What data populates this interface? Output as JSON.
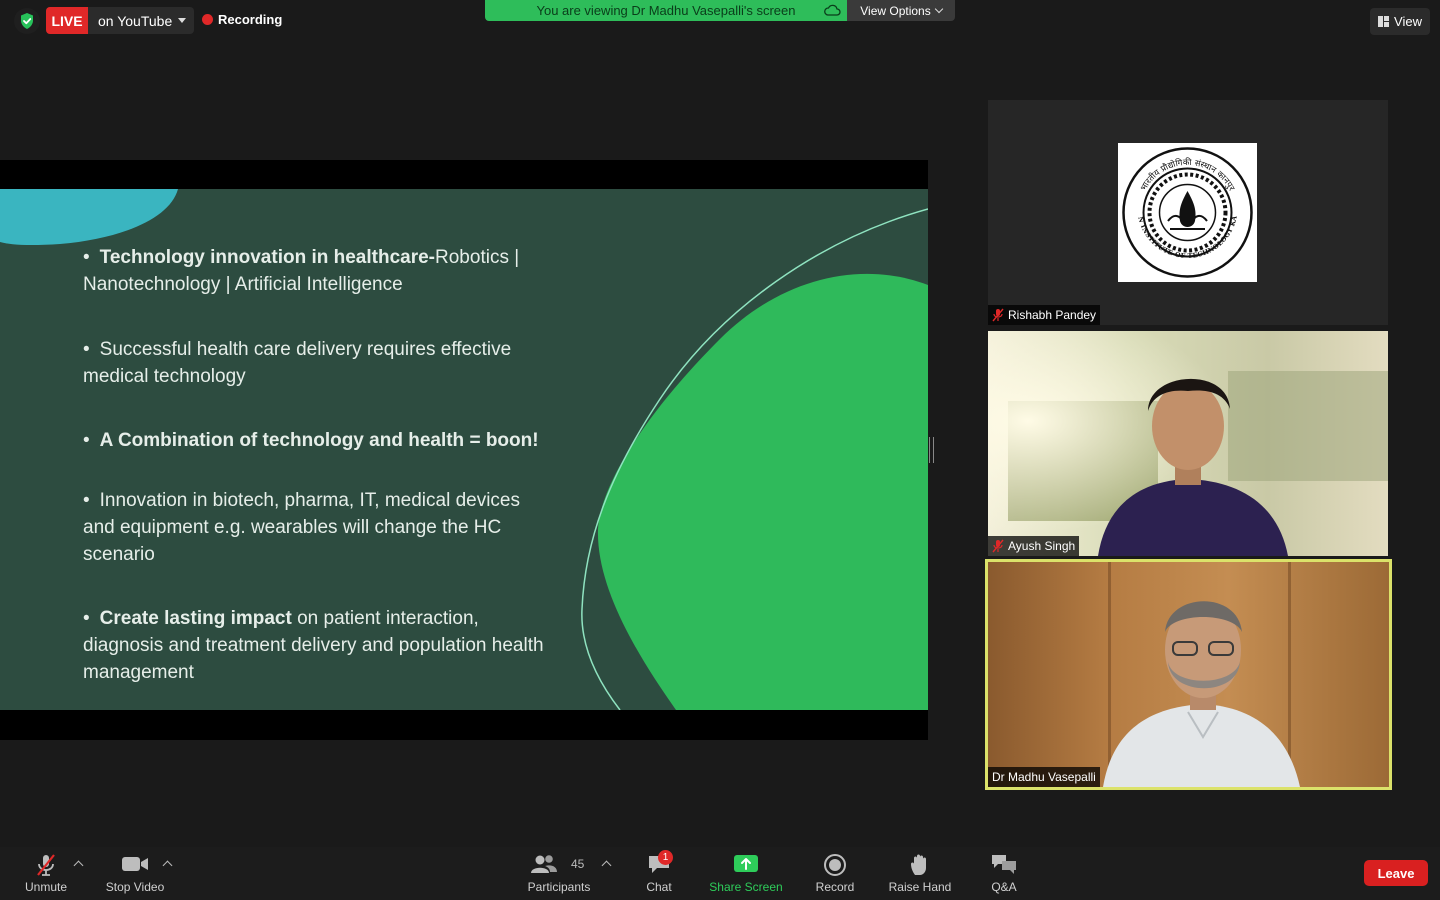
{
  "topbar": {
    "live_badge": "LIVE",
    "live_platform": "on YouTube",
    "recording_label": "Recording",
    "viewing_banner": "You are viewing Dr Madhu Vasepalli's screen",
    "view_options_label": "View Options",
    "view_label": "View"
  },
  "slide": {
    "bullets": [
      {
        "bold": "Technology innovation in healthcare-",
        "text": "Robotics | Nanotechnology | Artificial Intelligence"
      },
      {
        "bold": "",
        "text": "Successful health care delivery requires effective medical technology"
      },
      {
        "bold": "A Combination of technology and health = boon!",
        "text": ""
      },
      {
        "bold": "",
        "text": "Innovation in biotech, pharma, IT, medical devices and equipment e.g. wearables will change the HC scenario"
      },
      {
        "bold": "Create lasting impact",
        "text": " on patient interaction, diagnosis and treatment delivery and population health management"
      }
    ],
    "bullet_symbol": "•"
  },
  "participants": [
    {
      "name": "Rishabh Pandey",
      "muted": true,
      "video": "logo"
    },
    {
      "name": "Ayush Singh",
      "muted": true,
      "video": "camera"
    },
    {
      "name": "Dr Madhu Vasepalli",
      "muted": false,
      "video": "camera",
      "active_speaker": true
    }
  ],
  "logo": {
    "text_top": "भारतीय प्रौद्योगिकी संस्थान कानपुर",
    "text_bottom": "INDIAN INSTITUTE OF TECHNOLOGY KANPUR"
  },
  "toolbar": {
    "unmute_label": "Unmute",
    "stop_video_label": "Stop Video",
    "participants_label": "Participants",
    "participants_count": "45",
    "chat_label": "Chat",
    "chat_badge": "1",
    "share_screen_label": "Share Screen",
    "record_label": "Record",
    "raise_hand_label": "Raise Hand",
    "qa_label": "Q&A",
    "leave_label": "Leave"
  },
  "colors": {
    "accent_green": "#2ebd5a",
    "live_red": "#e02828",
    "slide_bg": "#2d4c40",
    "slide_blob": "#2fba5b",
    "slide_teal": "#3ab5c0",
    "active_speaker_border": "#dbe26a"
  }
}
